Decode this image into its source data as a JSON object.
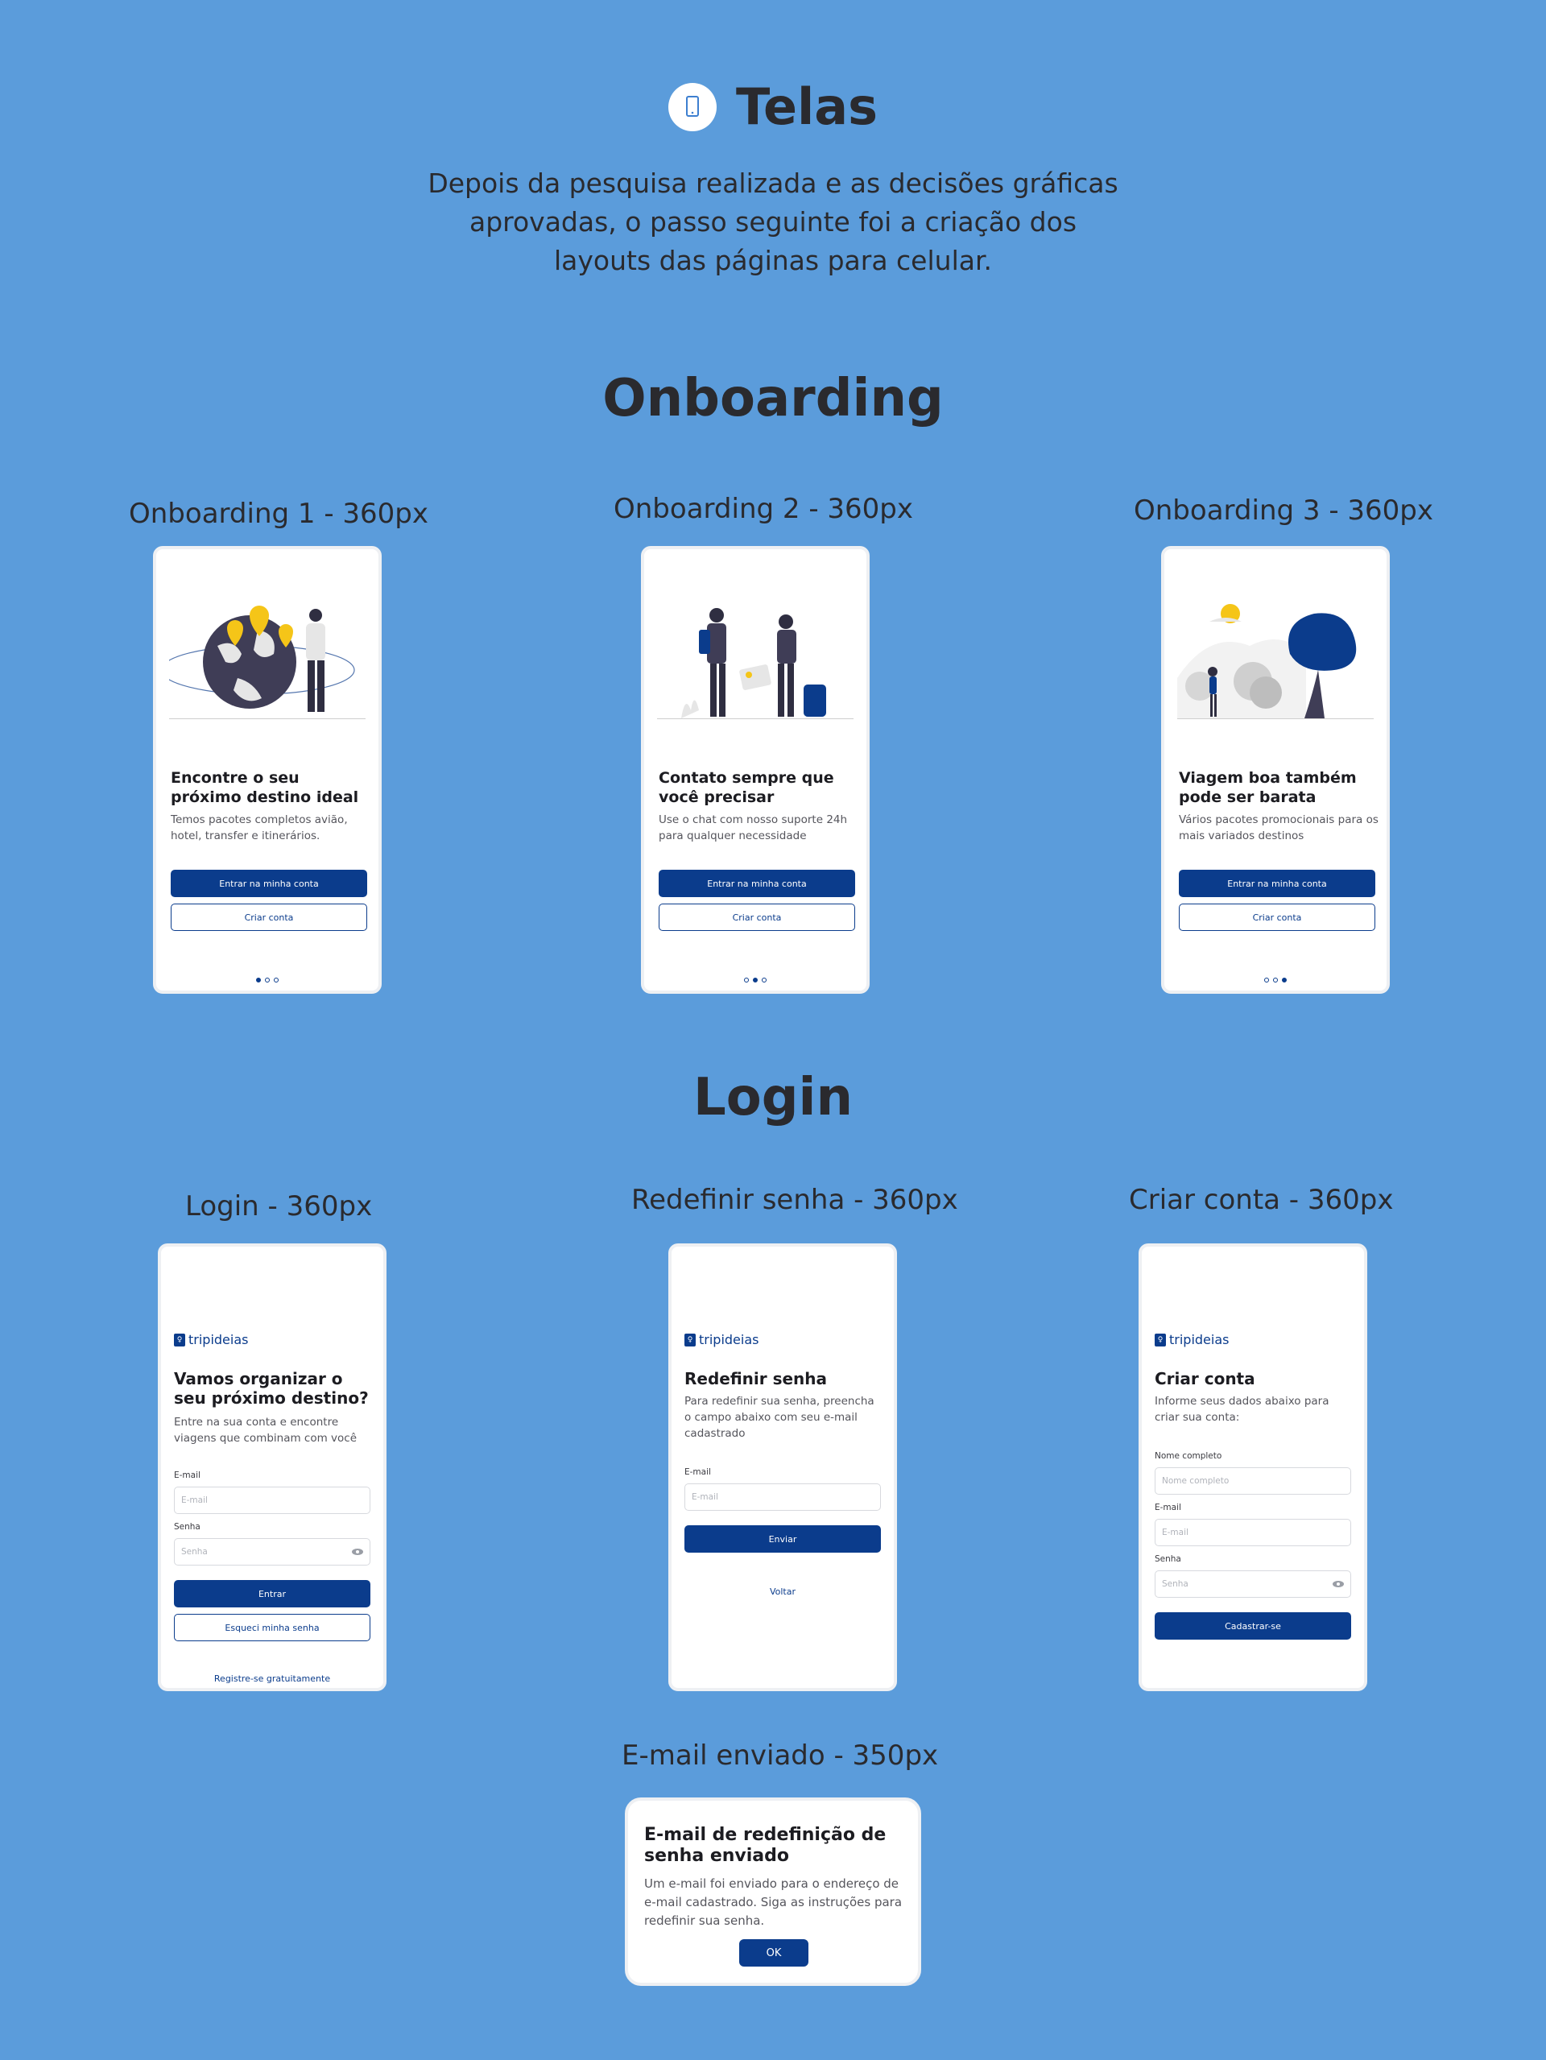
{
  "header": {
    "icon": "phone-icon",
    "title": "Telas",
    "intro": "Depois da pesquisa realizada e as decisões gráficas aprovadas, o passo seguinte foi a criação dos layouts das páginas para celular."
  },
  "onboarding": {
    "section_title": "Onboarding",
    "screens": [
      {
        "label": "Onboarding 1 - 360px",
        "illustration": "world-map-pins-illustration",
        "title": "Encontre o seu próximo destino ideal",
        "desc": "Temos pacotes completos avião, hotel, transfer e itinerários.",
        "primary": "Entrar na minha conta",
        "secondary": "Criar conta",
        "active_dot": 0
      },
      {
        "label": "Onboarding 2 - 360px",
        "illustration": "travelers-illustration",
        "title": "Contato sempre que você precisar",
        "desc": "Use o chat com nosso suporte 24h para qualquer necessidade",
        "primary": "Entrar na minha conta",
        "secondary": "Criar conta",
        "active_dot": 1
      },
      {
        "label": "Onboarding 3 - 360px",
        "illustration": "trees-sun-illustration",
        "title": "Viagem boa também pode ser barata",
        "desc": "Vários pacotes promocionais para os mais variados destinos",
        "primary": "Entrar na minha conta",
        "secondary": "Criar conta",
        "active_dot": 2
      }
    ]
  },
  "login": {
    "section_title": "Login",
    "logo_text": "tripideias",
    "login_screen": {
      "label": "Login - 360px",
      "title": "Vamos organizar o seu próximo destino?",
      "desc": "Entre na sua conta e encontre viagens que combinam com você",
      "email_label": "E-mail",
      "email_placeholder": "E-mail",
      "password_label": "Senha",
      "password_placeholder": "Senha",
      "submit": "Entrar",
      "forgot": "Esqueci minha senha",
      "register": "Registre-se gratuitamente"
    },
    "reset_screen": {
      "label": "Redefinir senha - 360px",
      "title": "Redefinir senha",
      "desc": "Para redefinir sua senha, preencha o campo abaixo com seu e-mail cadastrado",
      "email_label": "E-mail",
      "email_placeholder": "E-mail",
      "submit": "Enviar",
      "back": "Voltar"
    },
    "signup_screen": {
      "label": "Criar conta - 360px",
      "title": "Criar conta",
      "desc": "Informe seus dados abaixo para criar sua conta:",
      "name_label": "Nome completo",
      "name_placeholder": "Nome completo",
      "email_label": "E-mail",
      "email_placeholder": "E-mail",
      "password_label": "Senha",
      "password_placeholder": "Senha",
      "submit": "Cadastrar-se"
    },
    "email_sent": {
      "label": "E-mail enviado - 350px",
      "title": "E-mail de redefinição de senha enviado",
      "desc": "Um e-mail foi enviado para o endereço de e-mail cadastrado. Siga as instruções para redefinir sua senha.",
      "ok": "OK"
    }
  },
  "colors": {
    "background": "#5b9cdb",
    "primary": "#0b3c8c",
    "text": "#2a2a2e"
  }
}
